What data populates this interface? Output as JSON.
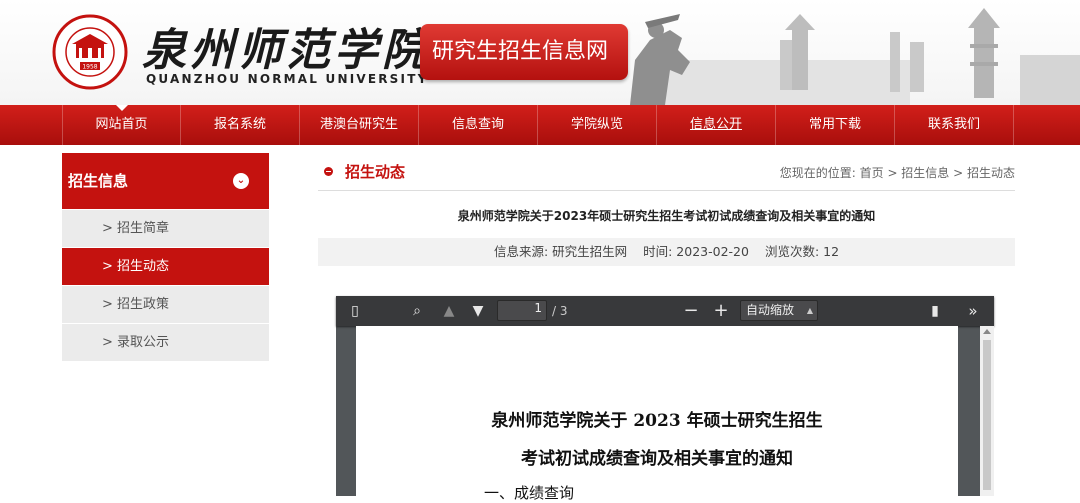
{
  "header": {
    "school_name": "泉州师范学院",
    "school_name_en": "QUANZHOU NORMAL UNIVERSITY",
    "seal_year": "1958",
    "site_title": "研究生招生信息网"
  },
  "nav": {
    "items": [
      "网站首页",
      "报名系统",
      "港澳台研究生",
      "信息查询",
      "学院纵览",
      "信息公开",
      "常用下载",
      "联系我们"
    ]
  },
  "sidebar": {
    "title": "招生信息",
    "items": [
      "> 招生简章",
      "> 招生动态",
      "> 招生政策",
      "> 录取公示"
    ],
    "active_index": 1
  },
  "main": {
    "section_title": "招生动态",
    "breadcrumb": "您现在的位置:  首页 >  招生信息 >  招生动态",
    "article_title": "泉州师范学院关于2023年硕士研究生招生考试初试成绩查询及相关事宜的通知",
    "meta": {
      "source": "信息来源:  研究生招生网",
      "time": "时间:  2023-02-20",
      "views": "浏览次数:  12"
    }
  },
  "pdf": {
    "page_current": "1",
    "page_total": "/ 3",
    "zoom": "自动缩放",
    "doc_title_line1": "泉州师范学院关于 2023 年硕士研究生招生",
    "doc_title_line2": "考试初试成绩查询及相关事宜的通知",
    "doc_first_line": "一、成绩查询"
  },
  "colors": {
    "brand_red": "#c4120f",
    "nav_red": "#d21f1a"
  }
}
